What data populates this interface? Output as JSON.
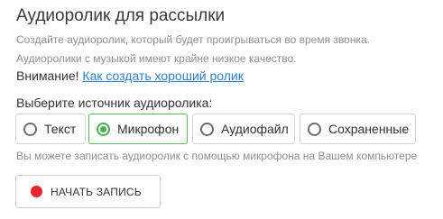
{
  "title": "Аудиоролик для рассылки",
  "hints": {
    "create": "Создайте аудиоролик, который будет проигрываться во время звонка.",
    "quality": "Аудиоролики с музыкой имеют крайне низкое качество."
  },
  "warning": {
    "prefix": "Внимание! ",
    "link_text": "Как создать хороший ролик"
  },
  "source": {
    "label": "Выберите источник аудиоролика:",
    "options": [
      {
        "label": "Текст",
        "selected": false
      },
      {
        "label": "Микрофон",
        "selected": true
      },
      {
        "label": "Аудиофайл",
        "selected": false
      },
      {
        "label": "Сохраненные",
        "selected": false
      }
    ]
  },
  "mic_hint": "Вы можете записать аудиоролик с помощью микрофона на Вашем компьютере",
  "record_button": {
    "label": "НАЧАТЬ ЗАПИСЬ",
    "dot_color": "#e3262e"
  },
  "colors": {
    "accent": "#4cae4c",
    "link": "#2a7fd4",
    "muted": "#8e8e8e"
  }
}
